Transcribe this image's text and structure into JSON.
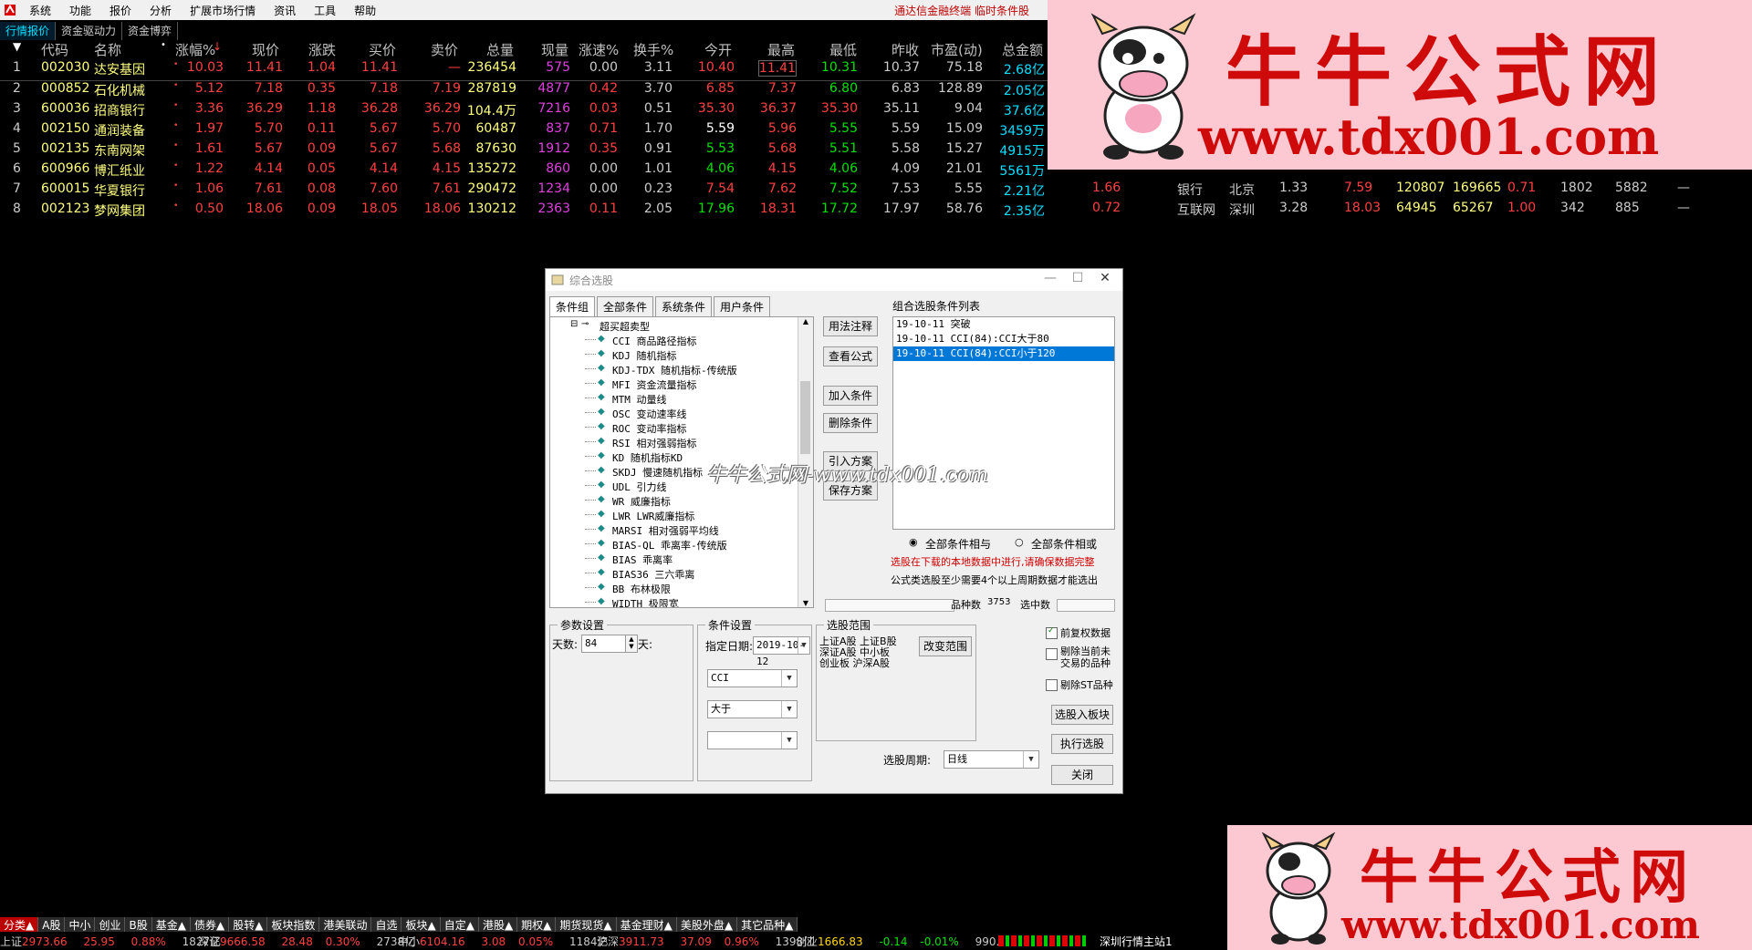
{
  "menu": {
    "items": [
      "系统",
      "功能",
      "报价",
      "分析",
      "扩展市场行情",
      "资讯",
      "工具",
      "帮助"
    ],
    "notice": "通达信金融终端 临时条件股"
  },
  "tabs": [
    "行情报价",
    "资金驱动力",
    "资金博弈"
  ],
  "columns": [
    "代码",
    "名称",
    "涨幅%",
    "现价",
    "涨跌",
    "买价",
    "卖价",
    "总量",
    "现量",
    "涨速%",
    "换手%",
    "今开",
    "最高",
    "最低",
    "昨收",
    "市盈(动)",
    "总金额"
  ],
  "rows": [
    {
      "n": "1",
      "code": "002030",
      "name": "达安基因",
      "chg": "10.03",
      "price": "11.41",
      "diff": "1.04",
      "bid": "11.41",
      "ask": "—",
      "vol": "236454",
      "cur": "575",
      "spd": "0.00",
      "turn": "3.11",
      "open": "10.40",
      "high": "11.41",
      "low": "10.31",
      "prev": "10.37",
      "pe": "75.18",
      "amt": "2.68亿",
      "extra": []
    },
    {
      "n": "2",
      "code": "000852",
      "name": "石化机械",
      "chg": "5.12",
      "price": "7.18",
      "diff": "0.35",
      "bid": "7.18",
      "ask": "7.19",
      "vol": "287819",
      "cur": "4877",
      "spd": "0.42",
      "turn": "3.70",
      "open": "6.85",
      "high": "7.37",
      "low": "6.80",
      "prev": "6.83",
      "pe": "128.89",
      "amt": "2.05亿",
      "extra": []
    },
    {
      "n": "3",
      "code": "600036",
      "name": "招商银行",
      "chg": "3.36",
      "price": "36.29",
      "diff": "1.18",
      "bid": "36.28",
      "ask": "36.29",
      "vol": "104.4万",
      "cur": "7216",
      "spd": "0.03",
      "turn": "0.51",
      "open": "35.30",
      "high": "36.37",
      "low": "35.30",
      "prev": "35.11",
      "pe": "9.04",
      "amt": "37.6亿",
      "extra": []
    },
    {
      "n": "4",
      "code": "002150",
      "name": "通润装备",
      "chg": "1.97",
      "price": "5.70",
      "diff": "0.11",
      "bid": "5.67",
      "ask": "5.70",
      "vol": "60487",
      "cur": "837",
      "spd": "0.71",
      "turn": "1.70",
      "open": "5.59",
      "high": "5.96",
      "low": "5.55",
      "prev": "5.59",
      "pe": "15.09",
      "amt": "3459万",
      "extra": []
    },
    {
      "n": "5",
      "code": "002135",
      "name": "东南网架",
      "chg": "1.61",
      "price": "5.67",
      "diff": "0.09",
      "bid": "5.67",
      "ask": "5.68",
      "vol": "87630",
      "cur": "1912",
      "spd": "0.35",
      "turn": "0.91",
      "open": "5.53",
      "high": "5.68",
      "low": "5.51",
      "prev": "5.58",
      "pe": "15.27",
      "amt": "4915万",
      "extra": []
    },
    {
      "n": "6",
      "code": "600966",
      "name": "博汇纸业",
      "chg": "1.22",
      "price": "4.14",
      "diff": "0.05",
      "bid": "4.14",
      "ask": "4.15",
      "vol": "135272",
      "cur": "860",
      "spd": "0.00",
      "turn": "1.01",
      "open": "4.06",
      "high": "4.15",
      "low": "4.06",
      "prev": "4.09",
      "pe": "21.01",
      "amt": "5561万",
      "extra": []
    },
    {
      "n": "7",
      "code": "600015",
      "name": "华夏银行",
      "chg": "1.06",
      "price": "7.61",
      "diff": "0.08",
      "bid": "7.60",
      "ask": "7.61",
      "vol": "290472",
      "cur": "1234",
      "spd": "0.00",
      "turn": "0.23",
      "open": "7.54",
      "high": "7.62",
      "low": "7.52",
      "prev": "7.53",
      "pe": "5.55",
      "amt": "2.21亿",
      "extra": [
        "1.66",
        "银行",
        "北京",
        "1.33",
        "7.59",
        "120807",
        "169665",
        "0.71",
        "1802",
        "5882",
        "—"
      ]
    },
    {
      "n": "8",
      "code": "002123",
      "name": "梦网集团",
      "chg": "0.50",
      "price": "18.06",
      "diff": "0.09",
      "bid": "18.05",
      "ask": "18.06",
      "vol": "130212",
      "cur": "2363",
      "spd": "0.11",
      "turn": "2.05",
      "open": "17.96",
      "high": "18.31",
      "low": "17.72",
      "prev": "17.97",
      "pe": "58.76",
      "amt": "2.35亿",
      "extra": [
        "0.72",
        "互联网",
        "深圳",
        "3.28",
        "18.03",
        "64945",
        "65267",
        "1.00",
        "342",
        "885",
        "—"
      ]
    }
  ],
  "watermark": {
    "title": "牛牛公式网",
    "url": "www.tdx001.com",
    "overlay": "牛牛公式网-www.tdx001.com"
  },
  "dialog": {
    "title": "综合选股",
    "tabs": [
      "条件组",
      "全部条件",
      "系统条件",
      "用户条件"
    ],
    "tree_root": "超买超卖型",
    "tree_items": [
      "CCI 商品路径指标",
      "KDJ 随机指标",
      "KDJ-TDX 随机指标-传统版",
      "MFI 资金流量指标",
      "MTM 动量线",
      "OSC 变动速率线",
      "ROC 变动率指标",
      "RSI 相对强弱指标",
      "KD 随机指标KD",
      "SKDJ 慢速随机指标",
      "UDL 引力线",
      "WR 威廉指标",
      "LWR LWR威廉指标",
      "MARSI 相对强弱平均线",
      "BIAS-QL 乖离率-传统版",
      "BIAS 乖离率",
      "BIAS36 三六乖离",
      "BB 布林极限",
      "WIDTH 极限宽"
    ],
    "buttons_mid": [
      "用法注释",
      "查看公式",
      "加入条件",
      "删除条件",
      "引入方案",
      "保存方案"
    ],
    "list_title": "组合选股条件列表",
    "list_items": [
      "19-10-11 突破",
      "19-10-11 CCI(84):CCI大于80",
      "19-10-11 CCI(84):CCI小于120"
    ],
    "radio_and": "全部条件相与",
    "radio_or": "全部条件相或",
    "warn1": "选股在下载的本地数据中进行,请确保数据完整",
    "warn2": "公式类选股至少需要4个以上周期数据才能选出",
    "count_label": "品种数",
    "count_value": "3753",
    "selected_label": "选中数",
    "param_title": "参数设置",
    "days_label": "天数:",
    "days_value": "84",
    "days_unit": "天:",
    "cond_title": "条件设置",
    "date_label": "指定日期:",
    "date_value": "2019-10-12",
    "cond_indicator": "CCI",
    "cond_op": "大于",
    "cond_value": "",
    "range_title": "选股范围",
    "range_text": [
      "上证A股 上证B股",
      "深证A股 中小板",
      "创业板 沪深A股"
    ],
    "change_range": "改变范围",
    "opt_restore": "前复权数据",
    "opt_exclude_today": "剔除当前未交易的品种",
    "opt_exclude_st": "剔除ST品种",
    "btn_to_block": "选股入板块",
    "btn_execute": "执行选股",
    "period_label": "选股周期:",
    "period_value": "日线",
    "btn_close": "关闭"
  },
  "status_tabs": [
    "分类▲",
    "A股",
    "中小",
    "创业",
    "B股",
    "基金▲",
    "债券▲",
    "股转▲",
    "板块指数",
    "港美联动",
    "自选",
    "板块▲",
    "自定▲",
    "港股▲",
    "期权▲",
    "期货现货▲",
    "基金理财▲",
    "美股外盘▲",
    "其它品种▲"
  ],
  "ticker": [
    {
      "label": "上证",
      "v": "2973.66",
      "d": "25.95",
      "p": "0.88%",
      "a": "1827亿"
    },
    {
      "label": "深证",
      "v": "9666.58",
      "d": "28.48",
      "p": "0.30%",
      "a": "2738亿"
    },
    {
      "label": "中小",
      "v": "6104.16",
      "d": "3.08",
      "p": "0.05%",
      "a": "1184亿"
    },
    {
      "label": "沪深",
      "v": "3911.73",
      "d": "37.09",
      "p": "0.96%",
      "a": "1398亿"
    },
    {
      "label": "创业",
      "v": "1666.83",
      "d": "-0.14",
      "p": "-0.01%",
      "a": "990.8亿"
    }
  ],
  "server": "深圳行情主站1"
}
